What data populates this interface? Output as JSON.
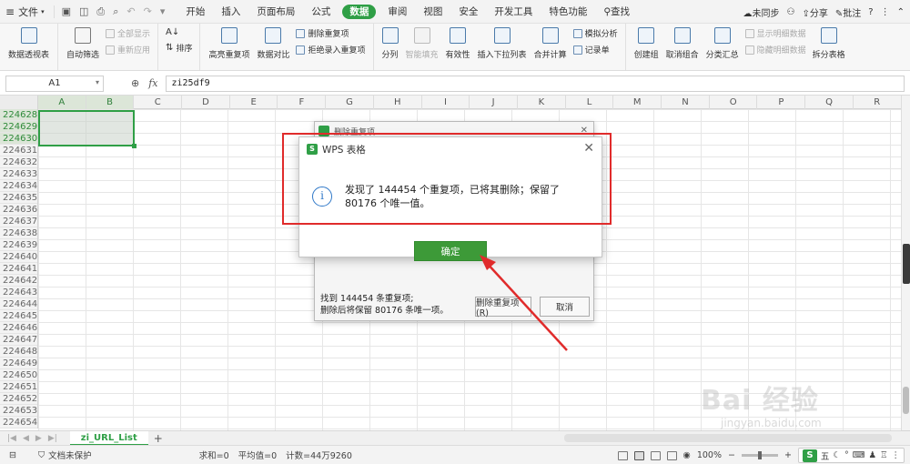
{
  "menubar": {
    "file_label": "文件",
    "tabs": [
      "开始",
      "插入",
      "页面布局",
      "公式",
      "数据",
      "审阅",
      "视图",
      "安全",
      "开发工具",
      "特色功能"
    ],
    "active_tab": "数据",
    "search_label": "查找",
    "sync_label": "未同步",
    "share_label": "分享",
    "comment_label": "批注"
  },
  "ribbon": {
    "pivot": "数据透视表",
    "autofilter": "自动筛选",
    "show_all": "全部显示",
    "reapply": "重新应用",
    "sort": "排序",
    "highlight_dup": "高亮重复项",
    "compare": "数据对比",
    "remove_dup": "删除重复项",
    "reject_dup": "拒绝录入重复项",
    "split": "分列",
    "smart_fill": "智能填充",
    "validation": "有效性",
    "insert_dropdown": "插入下拉列表",
    "consolidate": "合并计算",
    "simulate": "模拟分析",
    "record": "记录单",
    "group": "创建组",
    "ungroup": "取消组合",
    "subtotal": "分类汇总",
    "show_detail": "显示明细数据",
    "hide_detail": "隐藏明细数据",
    "split_table": "拆分表格"
  },
  "formula_bar": {
    "name_box": "A1",
    "fx": "fx",
    "value": "zi25df9"
  },
  "columns": [
    "A",
    "B",
    "C",
    "D",
    "E",
    "F",
    "G",
    "H",
    "I",
    "J",
    "K",
    "L",
    "M",
    "N",
    "O",
    "P",
    "Q",
    "R"
  ],
  "rows": [
    "224628",
    "224629",
    "224630",
    "224631",
    "224632",
    "224633",
    "224634",
    "224635",
    "224636",
    "224637",
    "224638",
    "224639",
    "224640",
    "224641",
    "224642",
    "224643",
    "224644",
    "224645",
    "224646",
    "224647",
    "224648",
    "224649",
    "224650",
    "224651",
    "224652",
    "224653",
    "224654"
  ],
  "dialog_back": {
    "title": "删除重复项",
    "found": "找到 144454 条重复项;",
    "remain": "删除后将保留 80176 条唯一项。",
    "delete_btn": "删除重复项(R)",
    "cancel_btn": "取消"
  },
  "dialog": {
    "title": "WPS 表格",
    "message": "发现了 144454 个重复项，已将其删除；保留了 80176 个唯一值。",
    "ok": "确定"
  },
  "sheet": {
    "tab": "zi_URL_List"
  },
  "status": {
    "protect": "文档未保护",
    "sum": "求和=0",
    "avg": "平均值=0",
    "count": "计数=44万9260",
    "zoom": "100%",
    "ime": "五"
  },
  "watermark": {
    "main": "Bai 经验",
    "sub": "jingyan.baidu.com"
  },
  "colors": {
    "accent": "#2f9f46",
    "annotation": "#e02b2b"
  }
}
